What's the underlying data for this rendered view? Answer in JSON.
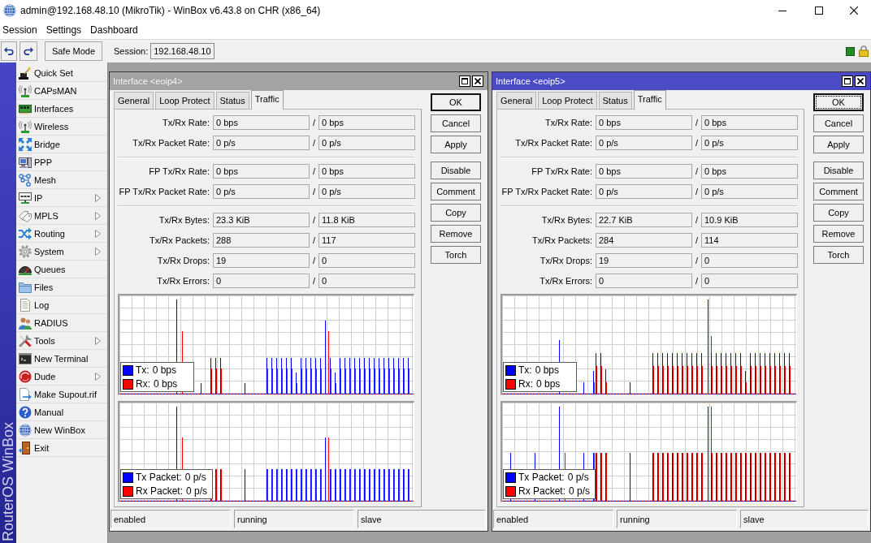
{
  "window": {
    "title": "admin@192.168.48.10 (MikroTik) - WinBox v6.43.8 on CHR (x86_64)"
  },
  "menu_bar": {
    "items": [
      "Session",
      "Settings",
      "Dashboard"
    ]
  },
  "toolbar": {
    "safe_mode_button": "Safe Mode",
    "session_label": "Session:",
    "session_value": "192.168.48.10"
  },
  "sidebar": {
    "brand": "RouterOS WinBox",
    "items": [
      {
        "label": "Quick Set",
        "submenu": false
      },
      {
        "label": "CAPsMAN",
        "submenu": false
      },
      {
        "label": "Interfaces",
        "submenu": false
      },
      {
        "label": "Wireless",
        "submenu": false
      },
      {
        "label": "Bridge",
        "submenu": false
      },
      {
        "label": "PPP",
        "submenu": false
      },
      {
        "label": "Mesh",
        "submenu": false
      },
      {
        "label": "IP",
        "submenu": true
      },
      {
        "label": "MPLS",
        "submenu": true
      },
      {
        "label": "Routing",
        "submenu": true
      },
      {
        "label": "System",
        "submenu": true
      },
      {
        "label": "Queues",
        "submenu": false
      },
      {
        "label": "Files",
        "submenu": false
      },
      {
        "label": "Log",
        "submenu": false
      },
      {
        "label": "RADIUS",
        "submenu": false
      },
      {
        "label": "Tools",
        "submenu": true
      },
      {
        "label": "New Terminal",
        "submenu": false
      },
      {
        "label": "Dude",
        "submenu": true
      },
      {
        "label": "Make Supout.rif",
        "submenu": false
      },
      {
        "label": "Manual",
        "submenu": false
      },
      {
        "label": "New WinBox",
        "submenu": false
      },
      {
        "label": "Exit",
        "submenu": false
      }
    ]
  },
  "windows": [
    {
      "title": "Interface <eoip4>",
      "active": false,
      "tabs": [
        {
          "label": "General",
          "selected": false
        },
        {
          "label": "Loop Protect",
          "selected": false
        },
        {
          "label": "Status",
          "selected": false
        },
        {
          "label": "Traffic",
          "selected": true
        }
      ],
      "field_groups": [
        {
          "rows": [
            {
              "label": "Tx/Rx Rate:",
              "tx": "0 bps",
              "divider": "/",
              "rx": "0 bps"
            },
            {
              "label": "Tx/Rx Packet Rate:",
              "tx": "0 p/s",
              "divider": "/",
              "rx": "0 p/s"
            }
          ]
        },
        {
          "rows": [
            {
              "label": "FP Tx/Rx Rate:",
              "tx": "0 bps",
              "divider": "/",
              "rx": "0 bps"
            },
            {
              "label": "FP Tx/Rx Packet Rate:",
              "tx": "0 p/s",
              "divider": "/",
              "rx": "0 p/s"
            }
          ]
        },
        {
          "rows": [
            {
              "label": "Tx/Rx Bytes:",
              "tx": "23.3 KiB",
              "divider": "/",
              "rx": "11.8 KiB"
            },
            {
              "label": "Tx/Rx Packets:",
              "tx": "288",
              "divider": "/",
              "rx": "117"
            },
            {
              "label": "Tx/Rx Drops:",
              "tx": "19",
              "divider": "/",
              "rx": "0"
            },
            {
              "label": "Tx/Rx Errors:",
              "tx": "0",
              "divider": "/",
              "rx": "0"
            }
          ]
        }
      ],
      "graphs": [
        {
          "legend": [
            {
              "label": "Tx:",
              "value": "0 bps",
              "color": "#0000ff"
            },
            {
              "label": "Rx:",
              "value": "0 bps",
              "color": "#ff0000"
            }
          ]
        },
        {
          "legend": [
            {
              "label": "Tx Packet:",
              "value": "0 p/s",
              "color": "#0000ff"
            },
            {
              "label": "Rx Packet:",
              "value": "0 p/s",
              "color": "#ff0000"
            }
          ]
        }
      ],
      "button_groups": [
        {
          "buttons": [
            {
              "label": "OK",
              "default": true,
              "focused": false
            },
            {
              "label": "Cancel",
              "default": false,
              "focused": false
            },
            {
              "label": "Apply",
              "default": false,
              "focused": false
            }
          ]
        },
        {
          "buttons": [
            {
              "label": "Disable",
              "default": false,
              "focused": false
            },
            {
              "label": "Comment",
              "default": false,
              "focused": false
            },
            {
              "label": "Copy",
              "default": false,
              "focused": false
            },
            {
              "label": "Remove",
              "default": false,
              "focused": false
            },
            {
              "label": "Torch",
              "default": false,
              "focused": false
            }
          ]
        }
      ],
      "status_bar": [
        "enabled",
        "running",
        "slave"
      ]
    },
    {
      "title": "Interface <eoip5>",
      "active": true,
      "tabs": [
        {
          "label": "General",
          "selected": false
        },
        {
          "label": "Loop Protect",
          "selected": false
        },
        {
          "label": "Status",
          "selected": false
        },
        {
          "label": "Traffic",
          "selected": true
        }
      ],
      "field_groups": [
        {
          "rows": [
            {
              "label": "Tx/Rx Rate:",
              "tx": "0 bps",
              "divider": "/",
              "rx": "0 bps"
            },
            {
              "label": "Tx/Rx Packet Rate:",
              "tx": "0 p/s",
              "divider": "/",
              "rx": "0 p/s"
            }
          ]
        },
        {
          "rows": [
            {
              "label": "FP Tx/Rx Rate:",
              "tx": "0 bps",
              "divider": "/",
              "rx": "0 bps"
            },
            {
              "label": "FP Tx/Rx Packet Rate:",
              "tx": "0 p/s",
              "divider": "/",
              "rx": "0 p/s"
            }
          ]
        },
        {
          "rows": [
            {
              "label": "Tx/Rx Bytes:",
              "tx": "22.7 KiB",
              "divider": "/",
              "rx": "10.9 KiB"
            },
            {
              "label": "Tx/Rx Packets:",
              "tx": "284",
              "divider": "/",
              "rx": "114"
            },
            {
              "label": "Tx/Rx Drops:",
              "tx": "19",
              "divider": "/",
              "rx": "0"
            },
            {
              "label": "Tx/Rx Errors:",
              "tx": "0",
              "divider": "/",
              "rx": "0"
            }
          ]
        }
      ],
      "graphs": [
        {
          "legend": [
            {
              "label": "Tx:",
              "value": "0 bps",
              "color": "#0000ff"
            },
            {
              "label": "Rx:",
              "value": "0 bps",
              "color": "#ff0000"
            }
          ]
        },
        {
          "legend": [
            {
              "label": "Tx Packet:",
              "value": "0 p/s",
              "color": "#0000ff"
            },
            {
              "label": "Rx Packet:",
              "value": "0 p/s",
              "color": "#ff0000"
            }
          ]
        }
      ],
      "button_groups": [
        {
          "buttons": [
            {
              "label": "OK",
              "default": true,
              "focused": true
            },
            {
              "label": "Cancel",
              "default": false,
              "focused": false
            },
            {
              "label": "Apply",
              "default": false,
              "focused": false
            }
          ]
        },
        {
          "buttons": [
            {
              "label": "Disable",
              "default": false,
              "focused": false
            },
            {
              "label": "Comment",
              "default": false,
              "focused": false
            },
            {
              "label": "Copy",
              "default": false,
              "focused": false
            },
            {
              "label": "Remove",
              "default": false,
              "focused": false
            },
            {
              "label": "Torch",
              "default": false,
              "focused": false
            }
          ]
        }
      ],
      "status_bar": [
        "enabled",
        "running",
        "slave"
      ]
    }
  ]
}
